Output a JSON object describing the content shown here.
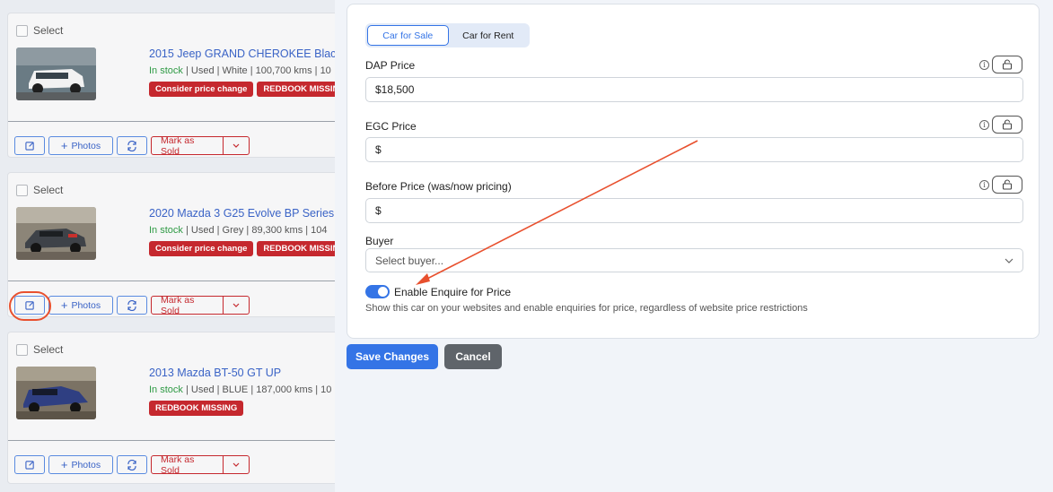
{
  "listings": [
    {
      "select_label": "Select",
      "title": "2015 Jeep GRAND CHEROKEE Blac",
      "stock": "In stock",
      "details": " | Used | White | 100,700 kms | 10",
      "badges": [
        "Consider price change",
        "REDBOOK MISSING"
      ]
    },
    {
      "select_label": "Select",
      "title": "2020 Mazda 3 G25 Evolve BP Series",
      "stock": "In stock",
      "details": " | Used | Grey | 89,300 kms | 104",
      "badges": [
        "Consider price change",
        "REDBOOK MISSING"
      ]
    },
    {
      "select_label": "Select",
      "title": "2013 Mazda BT-50 GT UP",
      "stock": "In stock",
      "details": " | Used | BLUE | 187,000 kms | 10",
      "badges": [
        "REDBOOK MISSING"
      ]
    }
  ],
  "toolbar": {
    "photos_label": "Photos",
    "mark_sold_label": "Mark as Sold"
  },
  "form": {
    "tabs": [
      "Car for Sale",
      "Car for Rent"
    ],
    "active_tab": "Car for Sale",
    "dap_price": {
      "label": "DAP Price",
      "value": "$18,500"
    },
    "egc_price": {
      "label": "EGC Price",
      "value": "$"
    },
    "before_price": {
      "label": "Before Price (was/now pricing)",
      "value": "$"
    },
    "buyer": {
      "label": "Buyer",
      "placeholder": "Select buyer..."
    },
    "enquire": {
      "label": "Enable Enquire for Price",
      "enabled": true,
      "help": "Show this car on your websites and enable enquiries for price, regardless of website price restrictions"
    }
  },
  "actions": {
    "save_label": "Save Changes",
    "cancel_label": "Cancel"
  },
  "colors": {
    "primary": "#3474e6",
    "danger": "#c5282e",
    "success": "#2e9a44",
    "annotation": "#e8502e",
    "link": "#3a63c6"
  }
}
